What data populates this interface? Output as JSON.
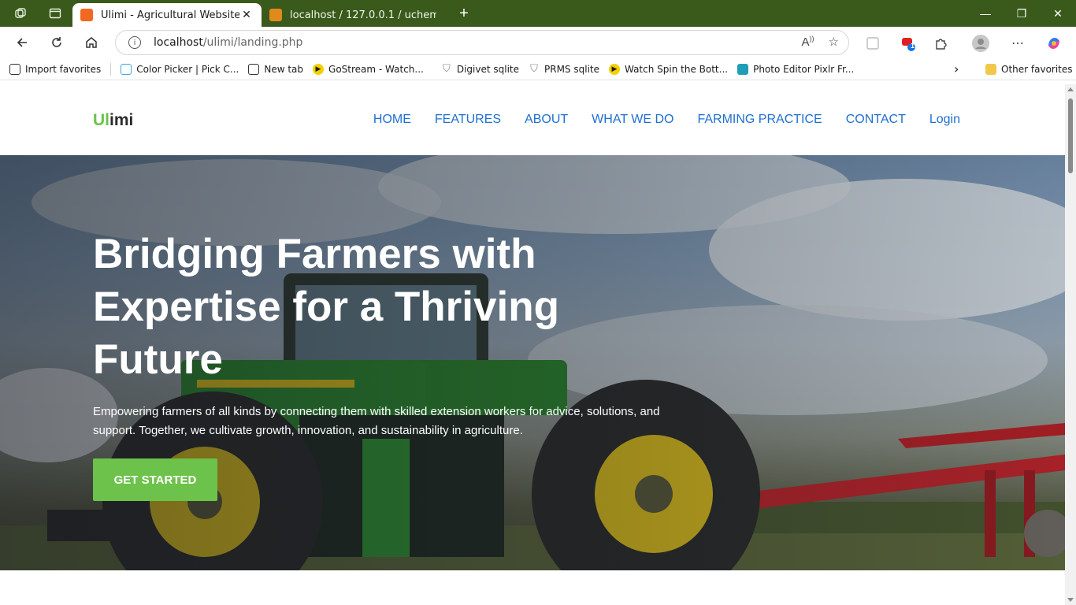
{
  "browser": {
    "tabs": [
      {
        "title": "Ulimi - Agricultural Website",
        "active": true
      },
      {
        "title": "localhost / 127.0.0.1 / uchembere",
        "active": false
      }
    ],
    "address": {
      "host": "localhost",
      "path": "/ulimi/landing.php"
    },
    "extension_badge": "1",
    "favorites": [
      "Import favorites",
      "Color Picker | Pick C...",
      "New tab",
      "GoStream - Watch...",
      "Digivet sqlite",
      "PRMS sqlite",
      "Watch Spin the Bott...",
      "Photo Editor Pixlr Fr..."
    ],
    "other_favorites": "Other favorites",
    "theme_color": "#3a5a1c"
  },
  "site": {
    "logo": {
      "accent": "Ul",
      "rest": "imi"
    },
    "nav": [
      "HOME",
      "FEATURES",
      "ABOUT",
      "WHAT WE DO",
      "FARMING PRACTICE",
      "CONTACT",
      "Login"
    ],
    "hero": {
      "title": "Bridging Farmers with Expertise for a Thriving Future",
      "subtitle": "Empowering farmers of all kinds by connecting them with skilled extension workers for advice, solutions, and support. Together, we cultivate growth, innovation, and sustainability in agriculture.",
      "cta": "GET STARTED"
    },
    "colors": {
      "accent_green": "#6cc24a",
      "nav_blue": "#1f6fd1"
    }
  }
}
